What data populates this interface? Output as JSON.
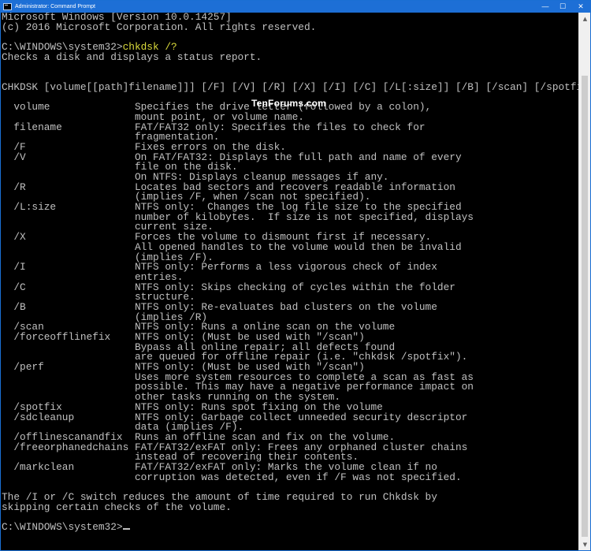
{
  "window": {
    "title": "Administrator: Command Prompt",
    "controls": {
      "minimize": "—",
      "maximize": "☐",
      "close": "✕"
    }
  },
  "watermark": "TenForums.com",
  "console": {
    "lines": [
      "Microsoft Windows [Version 10.0.14257]",
      "(c) 2016 Microsoft Corporation. All rights reserved.",
      "",
      "C:\\WINDOWS\\system32>",
      "Checks a disk and displays a status report.",
      "",
      "",
      "CHKDSK [volume[[path]filename]]] [/F] [/V] [/R] [/X] [/I] [/C] [/L[:size]] [/B] [/scan] [/spotfix]",
      "",
      "  volume              Specifies the drive letter (followed by a colon),",
      "                      mount point, or volume name.",
      "  filename            FAT/FAT32 only: Specifies the files to check for",
      "                      fragmentation.",
      "  /F                  Fixes errors on the disk.",
      "  /V                  On FAT/FAT32: Displays the full path and name of every",
      "                      file on the disk.",
      "                      On NTFS: Displays cleanup messages if any.",
      "  /R                  Locates bad sectors and recovers readable information",
      "                      (implies /F, when /scan not specified).",
      "  /L:size             NTFS only:  Changes the log file size to the specified",
      "                      number of kilobytes.  If size is not specified, displays",
      "                      current size.",
      "  /X                  Forces the volume to dismount first if necessary.",
      "                      All opened handles to the volume would then be invalid",
      "                      (implies /F).",
      "  /I                  NTFS only: Performs a less vigorous check of index",
      "                      entries.",
      "  /C                  NTFS only: Skips checking of cycles within the folder",
      "                      structure.",
      "  /B                  NTFS only: Re-evaluates bad clusters on the volume",
      "                      (implies /R)",
      "  /scan               NTFS only: Runs a online scan on the volume",
      "  /forceofflinefix    NTFS only: (Must be used with \"/scan\")",
      "                      Bypass all online repair; all defects found",
      "                      are queued for offline repair (i.e. \"chkdsk /spotfix\").",
      "  /perf               NTFS only: (Must be used with \"/scan\")",
      "                      Uses more system resources to complete a scan as fast as",
      "                      possible. This may have a negative performance impact on",
      "                      other tasks running on the system.",
      "  /spotfix            NTFS only: Runs spot fixing on the volume",
      "  /sdcleanup          NTFS only: Garbage collect unneeded security descriptor",
      "                      data (implies /F).",
      "  /offlinescanandfix  Runs an offline scan and fix on the volume.",
      "  /freeorphanedchains FAT/FAT32/exFAT only: Frees any orphaned cluster chains",
      "                      instead of recovering their contents.",
      "  /markclean          FAT/FAT32/exFAT only: Marks the volume clean if no",
      "                      corruption was detected, even if /F was not specified.",
      "",
      "The /I or /C switch reduces the amount of time required to run Chkdsk by",
      "skipping certain checks of the volume.",
      "",
      "C:\\WINDOWS\\system32>"
    ],
    "command": "chkdsk /?"
  }
}
